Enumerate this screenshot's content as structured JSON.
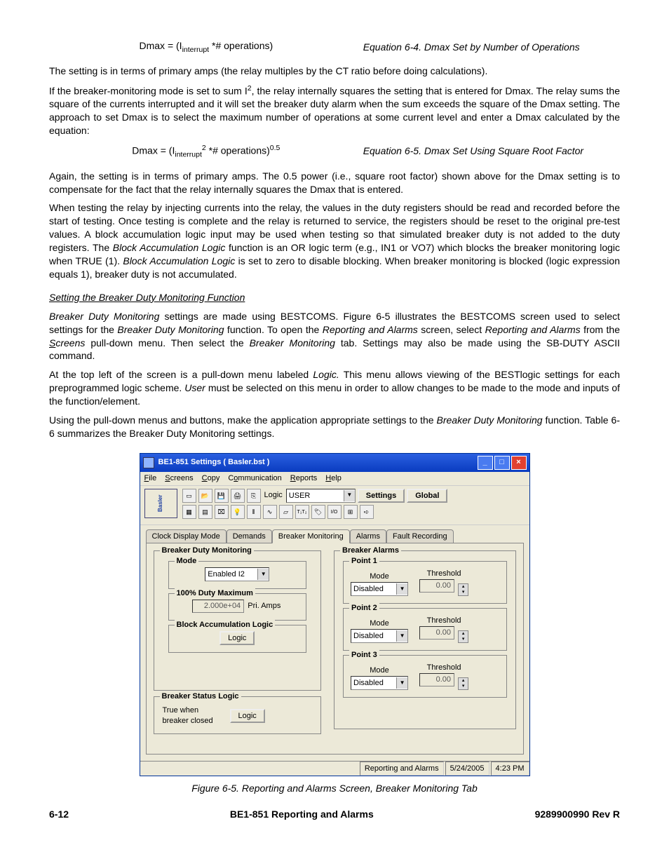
{
  "eq1": {
    "text": "Dmax = (I_interrupt * # operations)",
    "caption": "Equation 6-4. Dmax Set by Number of Operations"
  },
  "p1": "The setting is in terms of primary amps (the relay multiples by the CT ratio before doing calculations).",
  "p2a": "If the breaker-monitoring mode is set to sum ",
  "p2b": ", the relay internally squares the setting that is entered for Dmax. The relay sums the square of the currents interrupted and it will set the breaker duty alarm when the sum exceeds the square of the Dmax setting. The approach to set Dmax is to select the maximum number of operations at some current level and enter a Dmax calculated by the equation:",
  "eq2": {
    "text": "Dmax = (I_interrupt^2 * # operations)^0.5",
    "caption": "Equation 6-5. Dmax Set Using Square Root Factor"
  },
  "p3": "Again, the setting is in terms of primary amps. The 0.5 power (i.e., square root factor) shown above for the Dmax setting is to compensate for the fact that the relay internally squares the Dmax that is entered.",
  "p4a": "When testing the relay by injecting currents into the relay, the values in the duty registers should be read and recorded before the start of testing. Once testing is complete and the relay is returned to service, the registers should be reset to the original pre-test values. A block accumulation logic input may be used when testing so that simulated breaker duty is not added to the duty registers. The ",
  "p4b": "Block Accumulation Logic",
  "p4c": " function is an OR logic term (e.g., IN1 or VO7) which blocks the breaker monitoring logic when TRUE (1). ",
  "p4d": "Block Accumulation Logic",
  "p4e": " is set to zero to disable blocking. When breaker monitoring is blocked (logic expression equals 1), breaker duty is not accumulated.",
  "h1": "Setting the Breaker Duty Monitoring Function",
  "p5a": "Breaker Duty Monitoring",
  "p5b": " settings are made using BESTCOMS. Figure 6-5 illustrates the BESTCOMS screen used to select settings for the ",
  "p5c": "Breaker Duty Monitoring",
  "p5d": " function. To open the ",
  "p5e": "Reporting and Alarms",
  "p5f": " screen, select ",
  "p5g": "Reporting and Alarms",
  "p5h": " from the ",
  "p5i": "Screens",
  "p5j": " pull-down menu. Then select the ",
  "p5k": "Breaker Monitoring",
  "p5l": " tab. Settings may also be made using the SB-DUTY ASCII command.",
  "p6a": "At the top left of the screen is a pull-down menu labeled ",
  "p6b": "Logic.",
  "p6c": " This menu allows viewing of the BESTlogic settings for each preprogrammed logic scheme. ",
  "p6d": "User",
  "p6e": " must be selected on this menu in order to allow changes to be made to the mode and inputs of the function/element.",
  "p7a": "Using the pull-down menus and buttons, make the application appropriate settings to the ",
  "p7b": "Breaker Duty Monitoring",
  "p7c": " function. Table 6-6 summarizes the Breaker Duty Monitoring settings.",
  "win": {
    "title": "BE1-851 Settings   ( Basler.bst )",
    "menu": [
      "File",
      "Screens",
      "Copy",
      "Communication",
      "Reports",
      "Help"
    ],
    "logicLabel": "Logic",
    "logicValue": "USER",
    "settingsBtn": "Settings",
    "globalBtn": "Global",
    "tabs": [
      "Clock Display Mode",
      "Demands",
      "Breaker Monitoring",
      "Alarms",
      "Fault Recording"
    ],
    "activeTab": 2,
    "bdm": {
      "legend": "Breaker Duty Monitoring",
      "mode": {
        "label": "Mode",
        "value": "Enabled I2"
      },
      "duty": {
        "label": "100% Duty Maximum",
        "value": "2.000e+04",
        "unit": "Pri. Amps"
      },
      "bal": {
        "label": "Block Accumulation Logic",
        "btn": "Logic"
      },
      "bsl": {
        "legend": "Breaker Status Logic",
        "text": "True when breaker closed",
        "btn": "Logic"
      }
    },
    "alarms": {
      "legend": "Breaker Alarms",
      "points": [
        {
          "legend": "Point 1",
          "modeLabel": "Mode",
          "modeValue": "Disabled",
          "thLabel": "Threshold",
          "thValue": "0.00"
        },
        {
          "legend": "Point 2",
          "modeLabel": "Mode",
          "modeValue": "Disabled",
          "thLabel": "Threshold",
          "thValue": "0.00"
        },
        {
          "legend": "Point 3",
          "modeLabel": "Mode",
          "modeValue": "Disabled",
          "thLabel": "Threshold",
          "thValue": "0.00"
        }
      ]
    },
    "status": {
      "screen": "Reporting and Alarms",
      "date": "5/24/2005",
      "time": "4:23 PM"
    }
  },
  "figcap": "Figure 6-5. Reporting and Alarms Screen, Breaker Monitoring Tab",
  "footer": {
    "left": "6-12",
    "center": "BE1-851 Reporting and Alarms",
    "right": "9289900990 Rev R"
  }
}
